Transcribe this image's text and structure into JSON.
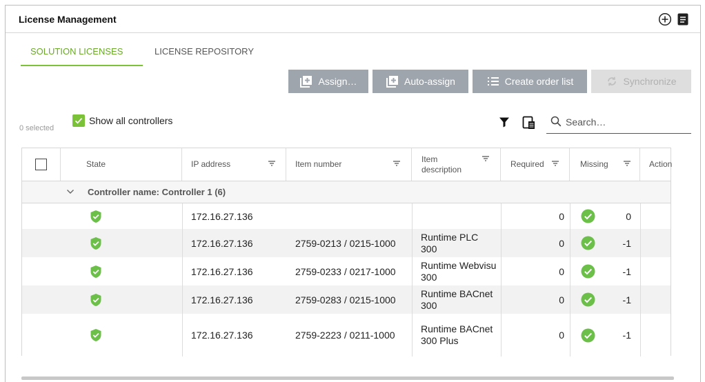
{
  "title": "License Management",
  "tabs": [
    {
      "label": "SOLUTION LICENSES",
      "active": true
    },
    {
      "label": "LICENSE REPOSITORY",
      "active": false
    }
  ],
  "toolbar": {
    "assign": "Assign…",
    "auto_assign": "Auto-assign",
    "create_order_list": "Create order list",
    "synchronize": "Synchronize"
  },
  "selection": {
    "count_label": "0 selected",
    "show_all_label": "Show all controllers",
    "show_all_checked": true
  },
  "search": {
    "placeholder": "Search…",
    "value": ""
  },
  "table": {
    "headers": {
      "state": "State",
      "ip": "IP address",
      "item_number": "Item number",
      "item_desc": "Item description",
      "required": "Required",
      "missing": "Missing",
      "action": "Action"
    },
    "group_label": "Controller name: Controller 1 (6)",
    "rows": [
      {
        "ip": "172.16.27.136",
        "item_number": "",
        "desc": "",
        "required": "0",
        "missing": "0"
      },
      {
        "ip": "172.16.27.136",
        "item_number": "2759-0213 / 0215-1000",
        "desc": "Runtime PLC 300",
        "required": "0",
        "missing": "-1"
      },
      {
        "ip": "172.16.27.136",
        "item_number": "2759-0233 / 0217-1000",
        "desc": "Runtime Webvisu 300",
        "required": "0",
        "missing": "-1"
      },
      {
        "ip": "172.16.27.136",
        "item_number": "2759-0283 / 0215-1000",
        "desc": "Runtime BACnet 300",
        "required": "0",
        "missing": "-1"
      },
      {
        "ip": "172.16.27.136",
        "item_number": "2759-2223 / 0211-1000",
        "desc": "Runtime BACnet 300 Plus",
        "required": "0",
        "missing": "-1"
      }
    ]
  },
  "colors": {
    "accent_green": "#7cc238",
    "status_green": "#6cc04a",
    "button_gray": "#9ea5ad",
    "button_disabled": "#dedede"
  },
  "icons": {
    "state": "shield-check-icon",
    "missing": "check-circle-icon"
  }
}
